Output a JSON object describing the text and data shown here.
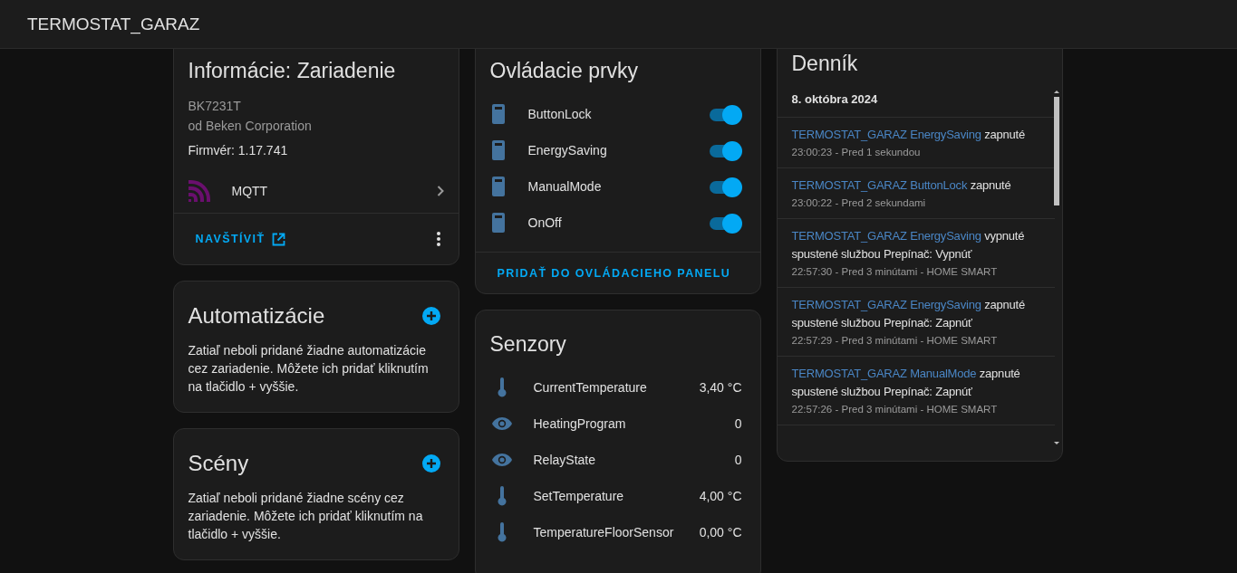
{
  "header": {
    "title": "TERMOSTAT_GARAZ"
  },
  "device_info": {
    "title": "Informácie: Zariadenie",
    "model": "BK7231T",
    "manufacturer": "od Beken Corporation",
    "firmware": "Firmvér: 1.17.741",
    "integration": "MQTT",
    "visit": "NAVŠTÍVIŤ"
  },
  "automations": {
    "title": "Automatizácie",
    "text": "Zatiaľ neboli pridané žiadne automatizácie cez zariadenie. Môžete ich pridať kliknutím na tlačidlo + vyššie."
  },
  "scenes": {
    "title": "Scény",
    "text": "Zatiaľ neboli pridané žiadne scény cez zariadenie. Môžete ich pridať kliknutím na tlačidlo + vyššie."
  },
  "controls": {
    "title": "Ovládacie prvky",
    "items": [
      {
        "name": "ButtonLock",
        "on": true
      },
      {
        "name": "EnergySaving",
        "on": true
      },
      {
        "name": "ManualMode",
        "on": true
      },
      {
        "name": "OnOff",
        "on": true
      }
    ],
    "add": "PRIDAŤ DO OVLÁDACIEHO PANELU"
  },
  "sensors": {
    "title": "Senzory",
    "items": [
      {
        "kind": "temperature",
        "name": "CurrentTemperature",
        "value": "3,40 °C"
      },
      {
        "kind": "eye",
        "name": "HeatingProgram",
        "value": "0"
      },
      {
        "kind": "eye",
        "name": "RelayState",
        "value": "0"
      },
      {
        "kind": "temperature",
        "name": "SetTemperature",
        "value": "4,00 °C"
      },
      {
        "kind": "temperature",
        "name": "TemperatureFloorSensor",
        "value": "0,00 °C"
      }
    ]
  },
  "logbook": {
    "title": "Denník",
    "date": "8. októbra 2024",
    "entries": [
      {
        "entity": "TERMOSTAT_GARAZ EnergySaving",
        "message": "zapnuté",
        "meta": "23:00:23 - Pred 1 sekundou"
      },
      {
        "entity": "TERMOSTAT_GARAZ ButtonLock",
        "message": "zapnuté",
        "meta": "23:00:22 - Pred 2 sekundami"
      },
      {
        "entity": "TERMOSTAT_GARAZ EnergySaving",
        "message": "vypnuté spustené službou Prepínač: Vypnúť",
        "meta": "22:57:30 - Pred 3 minútami - HOME SMART"
      },
      {
        "entity": "TERMOSTAT_GARAZ EnergySaving",
        "message": "zapnuté spustené službou Prepínač: Zapnúť",
        "meta": "22:57:29 - Pred 3 minútami - HOME SMART"
      },
      {
        "entity": "TERMOSTAT_GARAZ ManualMode",
        "message": "zapnuté spustené službou Prepínač: Zapnúť",
        "meta": "22:57:26 - Pred 3 minútami - HOME SMART"
      }
    ]
  }
}
